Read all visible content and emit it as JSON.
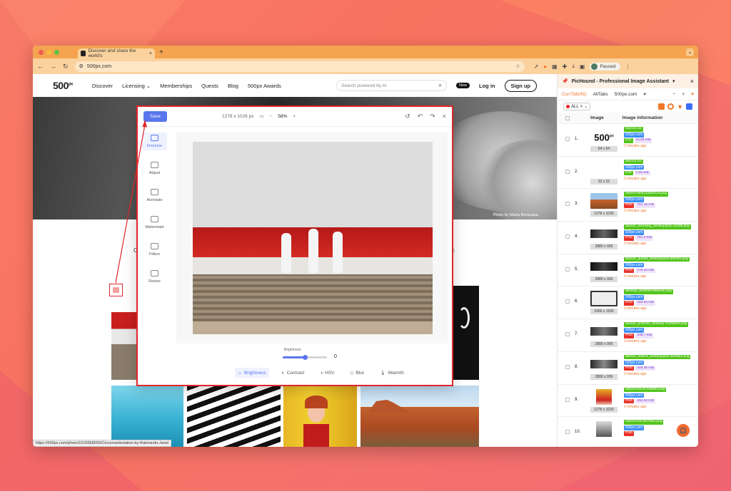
{
  "browser": {
    "tab_title": "Discover and share the world's",
    "tab_close": "×",
    "new_tab": "+",
    "url": "500px.com",
    "profile_status": "Paused"
  },
  "site": {
    "logo": "500",
    "logo_sup": "px",
    "nav": [
      "Discover",
      "Licensing",
      "Memberships",
      "Quests",
      "Blog",
      "500px Awards"
    ],
    "licensing_caret": "⌄",
    "search_placeholder": "Search powered by AI",
    "new_badge": "New",
    "login": "Log in",
    "signup": "Sign up",
    "photo_credit": "Photo by Marta Bevacqua",
    "side_letter_left": "C",
    "side_letter_right": "v.",
    "status_url": "https://500px.com/photo/1015068550/Circumambulation-by-Raimondo-Janel"
  },
  "editor": {
    "save": "Save",
    "dimensions": "1278 x 1026 px",
    "zoom": "58%",
    "tools": [
      "Finetune",
      "Adjust",
      "Annotate",
      "Watermark",
      "Filters",
      "Resize"
    ],
    "slider_label": "Brightness",
    "slider_value": "0",
    "slider_level_fraction": 0.5,
    "adjust_tabs": [
      "Brightness",
      "Contrast",
      "HSV",
      "Blur",
      "Warmth"
    ]
  },
  "extension": {
    "title": "PicHound - Professional Image Assistant",
    "title_caret": "▾",
    "close": "×",
    "tabs": [
      "CurrTab(45)",
      "AllTabs",
      "500px.com"
    ],
    "tabs_more": "▾",
    "filter_all": "ALL",
    "col_image": "Image",
    "col_info": "Image Information",
    "rows": [
      {
        "num": "1.",
        "dims": "64 x 64",
        "filename": "favicon.ico",
        "host": "500px.com",
        "type": "ICO",
        "size": "15.56 KiB",
        "ago": "3 minutes ago"
      },
      {
        "num": "2.",
        "dims": "32 x 32",
        "filename": "favicon.ico",
        "host": "500px.com",
        "type": "ICO",
        "size": "1.05 KiB",
        "ago": "3 minutes ago"
      },
      {
        "num": "3.",
        "dims": "1278 x 1026",
        "filename": "editors-b8f3c1d2e3c1a.png",
        "host": "500px.com",
        "type": "PNG",
        "size": "757.16 KiB",
        "ago": "3 minutes ago"
      },
      {
        "num": "4.",
        "dims": "2880 x 936",
        "filename": "banner_licensing_desktop@2x.4e3db.png",
        "host": "500px.com",
        "type": "PNG",
        "size": "761.3 KiB",
        "ago": "3 minutes ago"
      },
      {
        "num": "5.",
        "dims": "2880 x 936",
        "filename": "banner_quests_desktop@2x.0f6e9f2.png",
        "host": "500px.com",
        "type": "PNG",
        "size": "279.33 KiB",
        "ago": "3 minutes ago"
      },
      {
        "num": "6.",
        "dims": "2360 x 1183",
        "filename": "desktop_portfolio-b9fee4e.png",
        "host": "500px.com",
        "type": "PNG",
        "size": "424.93 KiB",
        "ago": "3 minutes ago"
      },
      {
        "num": "7.",
        "dims": "2880 x 900",
        "filename": "banner_portfolio_desktop.7e30b910.png",
        "host": "500px.com",
        "type": "PNG",
        "size": "338.7 KiB",
        "ago": "3 minutes ago"
      },
      {
        "num": "8.",
        "dims": "2880 x 936",
        "filename": "banner_editors_desktop@2x.0a4f5a1.png",
        "host": "500px.com",
        "type": "PNG",
        "size": "405.35 KiB",
        "ago": "3 minutes ago"
      },
      {
        "num": "9.",
        "dims": "1278 x 1026",
        "filename": "editors7d1c3c7a8b9a.png",
        "host": "500px.com",
        "type": "PNG",
        "size": "294.93 KiB",
        "ago": "3 minutes ago"
      },
      {
        "num": "10.",
        "dims": "",
        "filename": "editors7d1c3e7fae1.png",
        "host": "500px.com",
        "type": "PNG",
        "size": "",
        "ago": ""
      }
    ]
  },
  "colors": {
    "background": "#f7735f",
    "tab_strip": "#f5a34f",
    "accent_blue": "#5a76ee",
    "highlight_red": "#e0262a",
    "pichound_orange": "#f0772a"
  }
}
